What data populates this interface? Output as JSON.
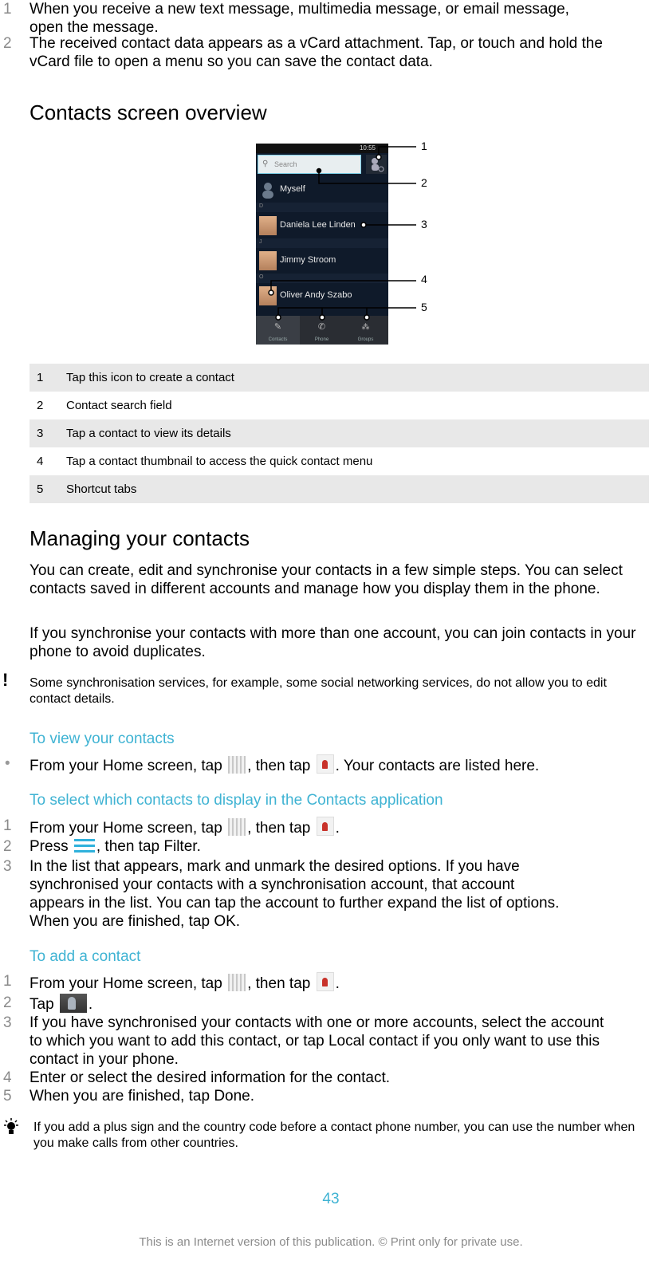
{
  "intro_steps": [
    {
      "num": "1",
      "text": "When you receive a new text message, multimedia message, or email message, open the message."
    },
    {
      "num": "2",
      "text": "The received contact data appears as a vCard attachment. Tap, or touch and hold the vCard file to open a menu so you can save the contact data."
    }
  ],
  "overview": {
    "title": "Contacts screen overview",
    "screenshot": {
      "status_time": "10:55",
      "search_placeholder": "Search",
      "contacts": [
        "Myself",
        "Daniela Lee Linden",
        "Jimmy Stroom",
        "Oliver Andy Szabo"
      ],
      "section_letters": [
        "D",
        "J",
        "O"
      ],
      "tabs": [
        "Contacts",
        "Phone",
        "Groups"
      ],
      "callouts": [
        "1",
        "2",
        "3",
        "4",
        "5"
      ]
    },
    "legend": [
      {
        "num": "1",
        "text": "Tap this icon to create a contact"
      },
      {
        "num": "2",
        "text": "Contact search field"
      },
      {
        "num": "3",
        "text": "Tap a contact to view its details"
      },
      {
        "num": "4",
        "text": "Tap a contact thumbnail to access the quick contact menu"
      },
      {
        "num": "5",
        "text": "Shortcut tabs"
      }
    ]
  },
  "managing": {
    "title": "Managing your contacts",
    "para1": "You can create, edit and synchronise your contacts in a few simple steps. You can select contacts saved in different accounts and manage how you display them in the phone.",
    "para2": "If you synchronise your contacts with more than one account, you can join contacts in your phone to avoid duplicates.",
    "warning": "Some synchronisation services, for example, some social networking services, do not allow you to edit contact details."
  },
  "view_contacts": {
    "title": "To view your contacts",
    "step_a": "From your Home screen, tap",
    "step_b": ", then tap",
    "step_c": ". Your contacts are listed here."
  },
  "select_contacts": {
    "title": "To select which contacts to display in the Contacts application",
    "s1_a": "From your Home screen, tap",
    "s1_b": ", then tap",
    "s1_c": ".",
    "s2_a": "Press",
    "s2_b": ", then tap",
    "s2_kw": "Filter",
    "s2_c": ".",
    "s3_a": "In the list that appears, mark and unmark the desired options. If you have synchronised your contacts with a synchronisation account, that account appears in the list. You can tap the account to further expand the list of options. When you are finished, tap",
    "s3_kw": "OK",
    "s3_c": "."
  },
  "add_contact": {
    "title": "To add a contact",
    "s1_a": "From your Home screen, tap",
    "s1_b": ", then tap",
    "s1_c": ".",
    "s2_a": "Tap",
    "s2_c": ".",
    "s3_a": "If you have synchronised your contacts with one or more accounts, select the account to which you want to add this contact, or tap",
    "s3_kw": "Local contact",
    "s3_c": "if you only want to use this contact in your phone.",
    "s4": "Enter or select the desired information for the contact.",
    "s5_a": "When you are finished, tap",
    "s5_kw": "Done",
    "s5_c": ".",
    "tip": "If you add a plus sign and the country code before a contact phone number, you can use the number when you make calls from other countries."
  },
  "footer": {
    "page_number": "43",
    "notice": "This is an Internet version of this publication. © Print only for private use."
  },
  "colors": {
    "heading_accent": "#3fb3d3",
    "step_number": "#8a8a8a",
    "table_shade": "#e8e8e8"
  }
}
